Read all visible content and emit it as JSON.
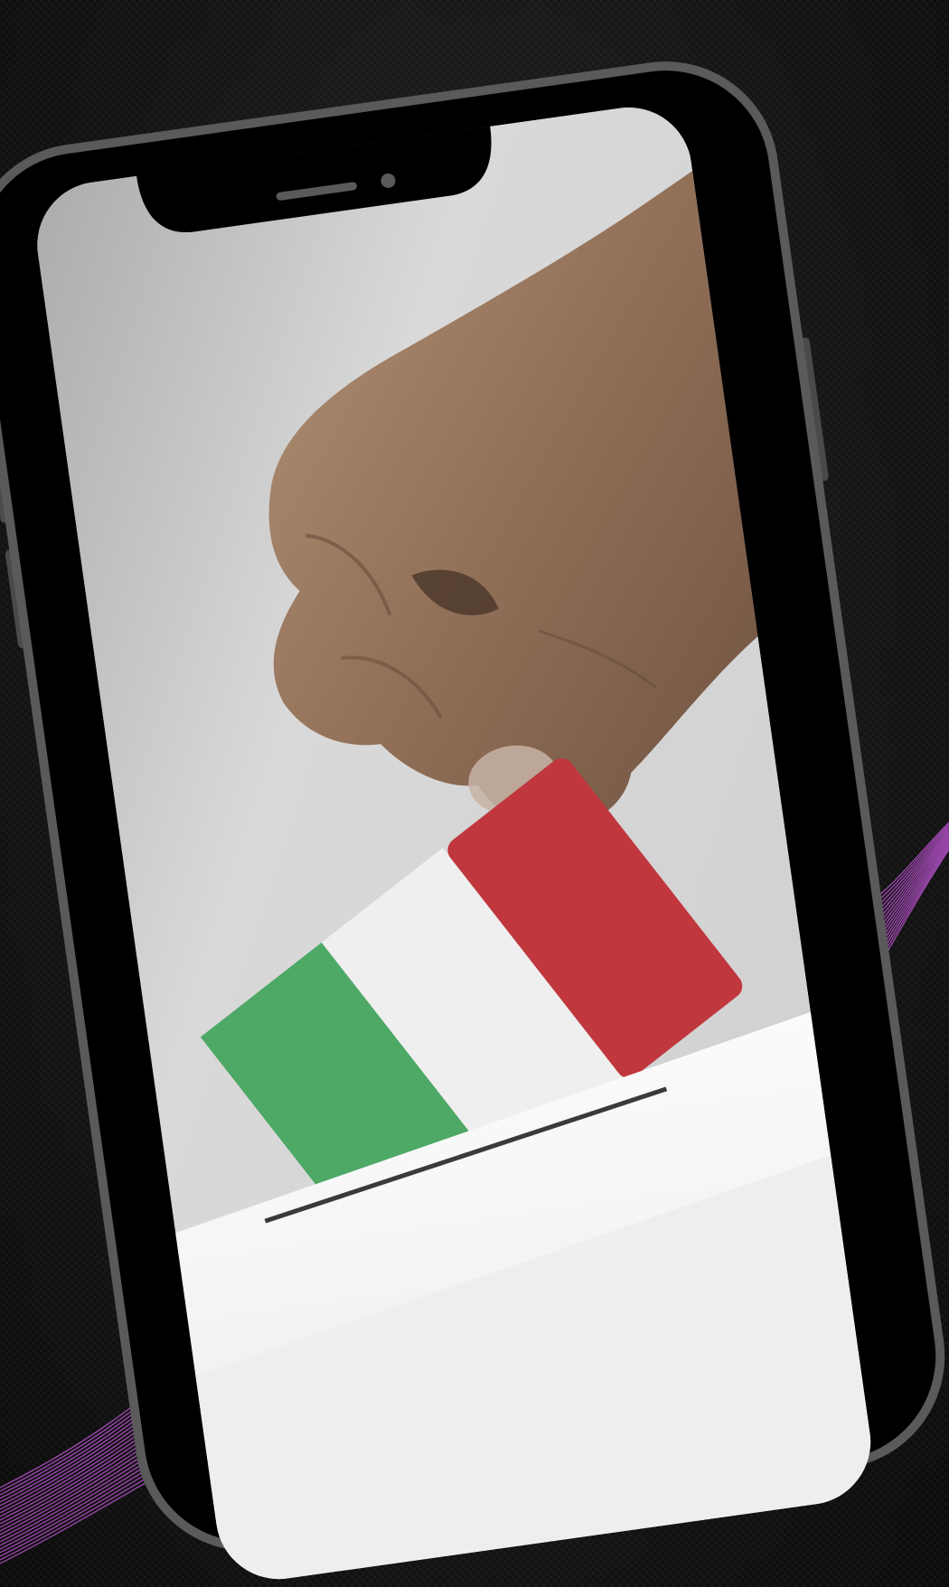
{
  "scene": {
    "background_color": "#121212",
    "accent_lines_color": "#b04fc4",
    "phone": {
      "frame_color": "#000000",
      "bezel_highlight_color": "#5a5a5a",
      "screen_bg_color": "#e6e6e6",
      "notch_icons": [
        "speaker-grille-icon",
        "front-camera-icon"
      ]
    },
    "photo": {
      "subject": "hand-inserting-ballot-into-box",
      "ballot_colors": {
        "green": "#4ea866",
        "white": "#efefef",
        "red": "#c0373d"
      },
      "skin_color": "#9a7b62",
      "ballot_box_color": "#f2f2f2",
      "slot_color": "#3a3a3a"
    }
  }
}
